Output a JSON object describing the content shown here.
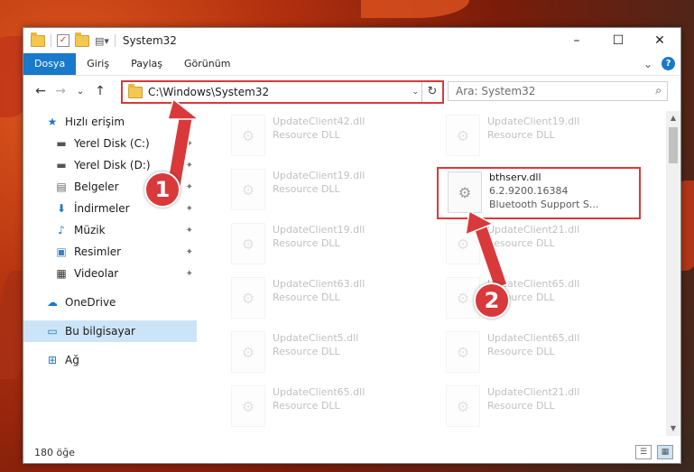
{
  "title_bar": {
    "title": "System32",
    "minimize": "–",
    "maximize": "☐",
    "close": "✕"
  },
  "ribbon": {
    "tabs": [
      "Dosya",
      "Giriş",
      "Paylaş",
      "Görünüm"
    ],
    "expand": "⌄",
    "help": "?"
  },
  "nav": {
    "back": "←",
    "forward": "→",
    "recent": "⌄",
    "up": "↑",
    "address": "C:\\Windows\\System32",
    "address_dropdown": "⌄",
    "refresh": "↻",
    "search_placeholder": "Ara: System32",
    "search_icon": "⌕"
  },
  "sidebar": {
    "items": [
      {
        "label": "Hızlı erişim",
        "icon": "star-icon",
        "glyph": "★",
        "pinned": false
      },
      {
        "label": "Yerel Disk (C:)",
        "icon": "drive-icon",
        "glyph": "▬",
        "pinned": true
      },
      {
        "label": "Yerel Disk (D:)",
        "icon": "drive-icon",
        "glyph": "▬",
        "pinned": true
      },
      {
        "label": "Belgeler",
        "icon": "documents-icon",
        "glyph": "▤",
        "pinned": true
      },
      {
        "label": "İndirmeler",
        "icon": "downloads-icon",
        "glyph": "⬇",
        "pinned": true
      },
      {
        "label": "Müzik",
        "icon": "music-icon",
        "glyph": "♪",
        "pinned": true
      },
      {
        "label": "Resimler",
        "icon": "pictures-icon",
        "glyph": "▣",
        "pinned": true
      },
      {
        "label": "Videolar",
        "icon": "videos-icon",
        "glyph": "▦",
        "pinned": true
      },
      {
        "label": "OneDrive",
        "icon": "cloud-icon",
        "glyph": "☁",
        "pinned": false
      },
      {
        "label": "Bu bilgisayar",
        "icon": "computer-icon",
        "glyph": "▭",
        "pinned": false
      },
      {
        "label": "Ağ",
        "icon": "network-icon",
        "glyph": "⊞",
        "pinned": false
      }
    ],
    "pin_glyph": "📌"
  },
  "files": [
    {
      "name": "UpdateClient42.dll",
      "desc": "Resource DLL"
    },
    {
      "name": "UpdateClient19.dll",
      "desc": "Resource DLL"
    },
    {
      "name": "UpdateClient19.dll",
      "desc": "Resource DLL"
    },
    {
      "name": "bthserv.dll",
      "version": "6.2.9200.16384",
      "desc": "Bluetooth Support S..."
    },
    {
      "name": "UpdateClient19.dll",
      "desc": "Resource DLL"
    },
    {
      "name": "UpdateClient21.dll",
      "desc": "Resource DLL"
    },
    {
      "name": "UpdateClient63.dll",
      "desc": "Resource DLL"
    },
    {
      "name": "UpdateClient65.dll",
      "desc": "Resource DLL"
    },
    {
      "name": "UpdateClient5.dll",
      "desc": "Resource DLL"
    },
    {
      "name": "UpdateClient65.dll",
      "desc": "Resource DLL"
    },
    {
      "name": "UpdateClient65.dll",
      "desc": "Resource DLL"
    },
    {
      "name": "UpdateClient21.dll",
      "desc": "Resource DLL"
    }
  ],
  "status": {
    "count": "180 öğe"
  },
  "callouts": [
    "1",
    "2"
  ],
  "colors": {
    "accent": "#1979ca",
    "highlight": "#d9393a"
  }
}
